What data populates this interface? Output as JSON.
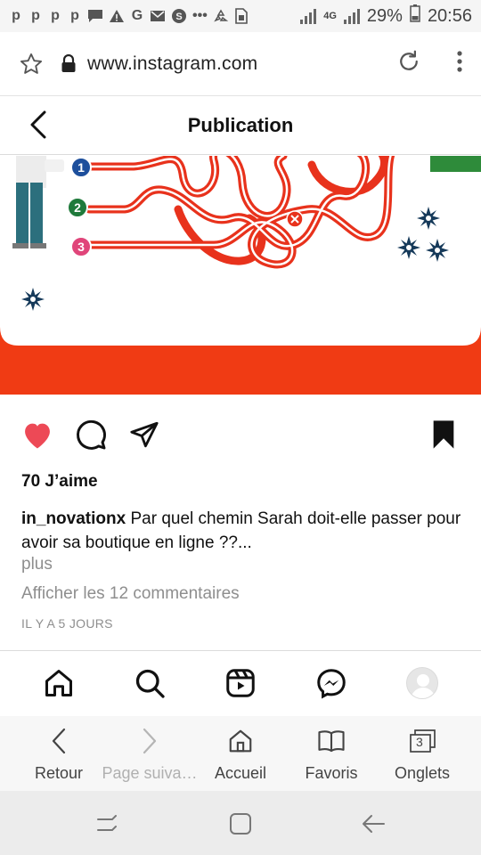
{
  "status_bar": {
    "left_icons": [
      "p",
      "p",
      "p",
      "p",
      "message-icon",
      "alert-icon",
      "G",
      "mail-icon",
      "S",
      "•••",
      "recycle-icon",
      "sim-icon"
    ],
    "network": "4G",
    "battery": "29%",
    "time": "20:56"
  },
  "browser": {
    "url": "www.instagram.com",
    "bottom_bar": {
      "back_label": "Retour",
      "forward_label": "Page suiva…",
      "home_label": "Accueil",
      "bookmarks_label": "Favoris",
      "tabs_label": "Onglets",
      "tabs_count": "3"
    }
  },
  "header": {
    "title": "Publication"
  },
  "post": {
    "image": {
      "markers": [
        "1",
        "2",
        "3"
      ],
      "colors": {
        "background": "#f03b14",
        "path": "#e8321c",
        "marker1": "#1d4f9c",
        "marker2": "#1f7a3b",
        "marker3": "#e0457a",
        "flower": "#163a5a"
      }
    },
    "likes": "70 J’aime",
    "username": "in_novationx",
    "caption": "Par quel chemin Sarah doit-elle passer pour avoir sa boutique en ligne ??...",
    "more_label": "plus",
    "comments_link": "Afficher les 12 commentaires",
    "timestamp": "IL Y A 5 JOURS",
    "liked": true
  },
  "colors": {
    "like": "#ed4956",
    "muted_text": "#8e8e8e"
  }
}
